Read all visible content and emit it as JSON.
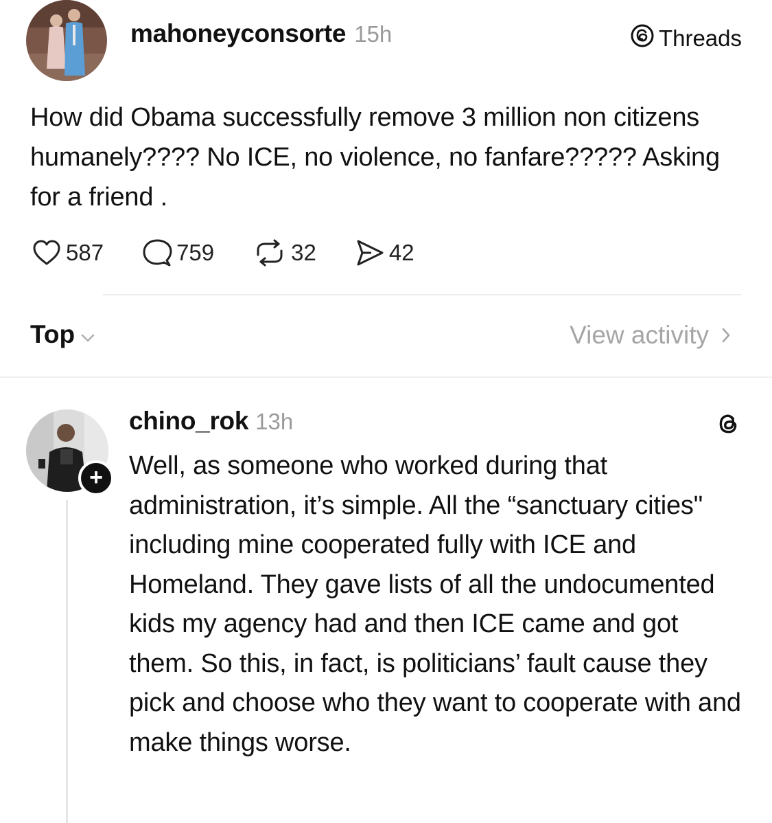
{
  "post": {
    "username": "mahoneyconsorte",
    "time": "15h",
    "source_label": "Threads",
    "text": "How did Obama successfully remove 3 million non citizens humanely???? No ICE, no violence, no fanfare????? Asking for a friend .",
    "stats": {
      "likes": "587",
      "replies": "759",
      "reposts": "32",
      "shares": "42"
    }
  },
  "sort": {
    "label": "Top"
  },
  "activity": {
    "label": "View activity"
  },
  "reply": {
    "username": "chino_rok",
    "time": "13h",
    "follow_symbol": "+",
    "text": "Well, as someone who worked during that administration, it’s simple. All the “sanctuary cities\" including mine cooperated fully with ICE and Homeland. They gave lists of all the undocumented kids my agency had and then ICE came and got them. So this, in fact, is politicians’ fault cause they pick and choose who they want to cooperate with and make things worse."
  },
  "icons": {
    "threads": "threads-logo-icon",
    "like": "heart-icon",
    "reply": "comment-bubble-icon",
    "repost": "repost-arrows-icon",
    "share": "send-icon",
    "sort": "chevron-down-icon",
    "activity": "chevron-right-icon"
  },
  "colors": {
    "text": "#111111",
    "muted": "#9a9a9a",
    "divider": "#ececec"
  }
}
